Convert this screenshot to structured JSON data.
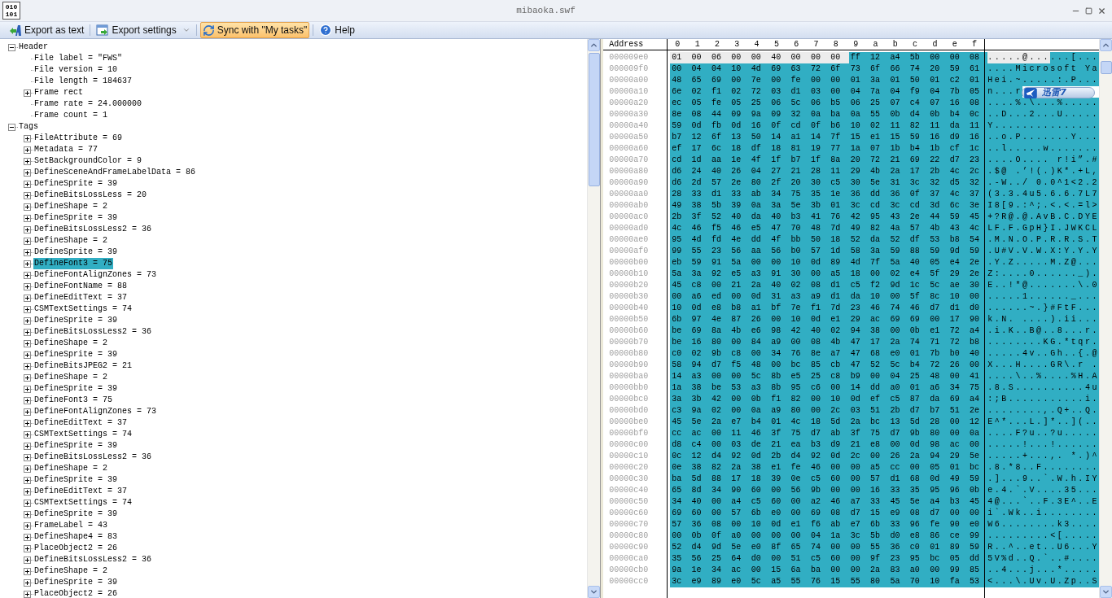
{
  "window": {
    "title": "mibaoka.swf",
    "app_icon_lines": [
      "010",
      "101"
    ]
  },
  "toolbar": [
    {
      "kind": "export-text",
      "label": "Export as text",
      "selected": false
    },
    {
      "kind": "settings",
      "label": "Export settings",
      "selected": false
    },
    {
      "kind": "sync",
      "label": "Sync with \"My tasks\"",
      "selected": true
    },
    {
      "kind": "help",
      "label": "Help",
      "selected": false
    }
  ],
  "tree": [
    {
      "label": "Header",
      "expanded": true,
      "selected": false,
      "children": [
        {
          "label": "File label = \"FWS\"",
          "selected": false
        },
        {
          "label": "File version = 10",
          "selected": false
        },
        {
          "label": "File length = 184637",
          "selected": false
        },
        {
          "label": "Frame rect",
          "expanded": false,
          "selected": false
        },
        {
          "label": "Frame rate = 24.000000",
          "selected": false
        },
        {
          "label": "Frame count = 1",
          "selected": false
        }
      ]
    },
    {
      "label": "Tags",
      "expanded": true,
      "selected": false,
      "children": [
        {
          "label": "FileAttribute = 69",
          "expanded": false,
          "selected": false
        },
        {
          "label": "Metadata = 77",
          "expanded": false,
          "selected": false
        },
        {
          "label": "SetBackgroundColor = 9",
          "expanded": false,
          "selected": false
        },
        {
          "label": "DefineSceneAndFrameLabelData = 86",
          "expanded": false,
          "selected": false
        },
        {
          "label": "DefineSprite = 39",
          "expanded": false,
          "selected": false
        },
        {
          "label": "DefineBitsLossLess = 20",
          "expanded": false,
          "selected": false
        },
        {
          "label": "DefineShape = 2",
          "expanded": false,
          "selected": false
        },
        {
          "label": "DefineSprite = 39",
          "expanded": false,
          "selected": false
        },
        {
          "label": "DefineBitsLossLess2 = 36",
          "expanded": false,
          "selected": false
        },
        {
          "label": "DefineShape = 2",
          "expanded": false,
          "selected": false
        },
        {
          "label": "DefineSprite = 39",
          "expanded": false,
          "selected": false
        },
        {
          "label": "DefineFont3 = 75",
          "expanded": false,
          "selected": true
        },
        {
          "label": "DefineFontAlignZones = 73",
          "expanded": false,
          "selected": false
        },
        {
          "label": "DefineFontName = 88",
          "expanded": false,
          "selected": false
        },
        {
          "label": "DefineEditText = 37",
          "expanded": false,
          "selected": false
        },
        {
          "label": "CSMTextSettings = 74",
          "expanded": false,
          "selected": false
        },
        {
          "label": "DefineSprite = 39",
          "expanded": false,
          "selected": false
        },
        {
          "label": "DefineBitsLossLess2 = 36",
          "expanded": false,
          "selected": false
        },
        {
          "label": "DefineShape = 2",
          "expanded": false,
          "selected": false
        },
        {
          "label": "DefineSprite = 39",
          "expanded": false,
          "selected": false
        },
        {
          "label": "DefineBitsJPEG2 = 21",
          "expanded": false,
          "selected": false
        },
        {
          "label": "DefineShape = 2",
          "expanded": false,
          "selected": false
        },
        {
          "label": "DefineSprite = 39",
          "expanded": false,
          "selected": false
        },
        {
          "label": "DefineFont3 = 75",
          "expanded": false,
          "selected": false
        },
        {
          "label": "DefineFontAlignZones = 73",
          "expanded": false,
          "selected": false
        },
        {
          "label": "DefineEditText = 37",
          "expanded": false,
          "selected": false
        },
        {
          "label": "CSMTextSettings = 74",
          "expanded": false,
          "selected": false
        },
        {
          "label": "DefineSprite = 39",
          "expanded": false,
          "selected": false
        },
        {
          "label": "DefineBitsLossLess2 = 36",
          "expanded": false,
          "selected": false
        },
        {
          "label": "DefineShape = 2",
          "expanded": false,
          "selected": false
        },
        {
          "label": "DefineSprite = 39",
          "expanded": false,
          "selected": false
        },
        {
          "label": "DefineEditText = 37",
          "expanded": false,
          "selected": false
        },
        {
          "label": "CSMTextSettings = 74",
          "expanded": false,
          "selected": false
        },
        {
          "label": "DefineSprite = 39",
          "expanded": false,
          "selected": false
        },
        {
          "label": "FrameLabel = 43",
          "expanded": false,
          "selected": false
        },
        {
          "label": "DefineShape4 = 83",
          "expanded": false,
          "selected": false
        },
        {
          "label": "PlaceObject2 = 26",
          "expanded": false,
          "selected": false
        },
        {
          "label": "DefineBitsLossLess2 = 36",
          "expanded": false,
          "selected": false
        },
        {
          "label": "DefineShape = 2",
          "expanded": false,
          "selected": false
        },
        {
          "label": "DefineSprite = 39",
          "expanded": false,
          "selected": false
        },
        {
          "label": "PlaceObject2 = 26",
          "expanded": false,
          "selected": false
        }
      ]
    }
  ],
  "hex_view": {
    "address_heading": "Address",
    "column_headings": [
      "0",
      "1",
      "2",
      "3",
      "4",
      "5",
      "6",
      "7",
      "8",
      "9",
      "a",
      "b",
      "c",
      "d",
      "e",
      "f"
    ],
    "rows": [
      {
        "address": "000009e0",
        "segments": [
          {
            "hex": "01 00 06 00 00 40 00 00 00",
            "ascii": ".....@...",
            "selected": false
          },
          {
            "hex": "ff 12 a4 5b 00 00 08",
            "ascii": "...[...",
            "selected": true
          }
        ]
      },
      {
        "address": "000009f0",
        "segments": [
          {
            "hex": "00 04 04 10 4d 69 63 72 6f 73 6f 66 74 20 59 61",
            "ascii": "....Microsoft Ya",
            "selected": true
          }
        ]
      },
      {
        "address": "00000a00",
        "segments": [
          {
            "hex": "48 65 69 00 7e 00 fe 00 00 01 3a 01 50 01 c2 01",
            "ascii": "Hei.~.....:.P...",
            "selected": true
          }
        ]
      },
      {
        "address": "00000a10",
        "segments": [
          {
            "hex": "6e 02 f1 02 72 03 d1 03 00 04 7a 04 f9 04 7b 05",
            "ascii": "n...r",
            "selected": true
          }
        ]
      },
      {
        "address": "00000a20",
        "segments": [
          {
            "hex": "ec 05 fe 05 25 06 5c 06 b5 06 25 07 c4 07 16 08",
            "ascii": "....%.\\...%.....",
            "selected": true
          }
        ]
      },
      {
        "address": "00000a30",
        "segments": [
          {
            "hex": "8e 08 44 09 9a 09 32 0a ba 0a 55 0b d4 0b b4 0c",
            "ascii": "..D...2...U.....",
            "selected": true
          }
        ]
      },
      {
        "address": "00000a40",
        "segments": [
          {
            "hex": "59 0d fb 0d 16 0f cd 0f b6 10 02 11 82 11 da 11",
            "ascii": "Y...............",
            "selected": true
          }
        ]
      },
      {
        "address": "00000a50",
        "segments": [
          {
            "hex": "b7 12 6f 13 50 14 a1 14 7f 15 e1 15 59 16 d9 16",
            "ascii": "..o.P.......Y...",
            "selected": true
          }
        ]
      },
      {
        "address": "00000a60",
        "segments": [
          {
            "hex": "ef 17 6c 18 df 18 81 19 77 1a 07 1b b4 1b cf 1c",
            "ascii": "..l.....w.......",
            "selected": true
          }
        ]
      },
      {
        "address": "00000a70",
        "segments": [
          {
            "hex": "cd 1d aa 1e 4f 1f b7 1f 8a 20 72 21 69 22 d7 23",
            "ascii": "....O.... r!i”.#",
            "selected": true
          }
        ]
      },
      {
        "address": "00000a80",
        "segments": [
          {
            "hex": "d6 24 40 26 04 27 21 28 11 29 4b 2a 17 2b 4c 2c",
            "ascii": ".$@ .’!(.)K*.+L,",
            "selected": true
          }
        ]
      },
      {
        "address": "00000a90",
        "segments": [
          {
            "hex": "d6 2d 57 2e 80 2f 20 30 c5 30 5e 31 3c 32 d5 32",
            "ascii": ".-W../ 0.0^1<2.2",
            "selected": true
          }
        ]
      },
      {
        "address": "00000aa0",
        "segments": [
          {
            "hex": "28 33 d1 33 ab 34 75 35 1e 36 dd 36 0f 37 4c 37",
            "ascii": "(3.3.4u5.6.6.7L7",
            "selected": true
          }
        ]
      },
      {
        "address": "00000ab0",
        "segments": [
          {
            "hex": "49 38 5b 39 0a 3a 5e 3b 01 3c cd 3c cd 3d 6c 3e",
            "ascii": "I8[9.:^;.<.<.=l>",
            "selected": true
          }
        ]
      },
      {
        "address": "00000ac0",
        "segments": [
          {
            "hex": "2b 3f 52 40 da 40 b3 41 76 42 95 43 2e 44 59 45",
            "ascii": "+?R@.@.AvB.C.DYE",
            "selected": true
          }
        ]
      },
      {
        "address": "00000ad0",
        "segments": [
          {
            "hex": "4c 46 f5 46 e5 47 70 48 7d 49 82 4a 57 4b 43 4c",
            "ascii": "LF.F.GpH}I.JWKCL",
            "selected": true
          }
        ]
      },
      {
        "address": "00000ae0",
        "segments": [
          {
            "hex": "95 4d fd 4e dd 4f bb 50 18 52 da 52 df 53 b8 54",
            "ascii": ".M.N.O.P.R.R.S.T",
            "selected": true
          }
        ]
      },
      {
        "address": "00000af0",
        "segments": [
          {
            "hex": "99 55 23 56 aa 56 b0 57 1d 58 3a 59 88 59 9d 59",
            "ascii": ".U#V.V.W.X:Y.Y.Y",
            "selected": true
          }
        ]
      },
      {
        "address": "00000b00",
        "segments": [
          {
            "hex": "eb 59 91 5a 00 00 10 0d 89 4d 7f 5a 40 05 e4 2e",
            "ascii": ".Y.Z.....M.Z@...",
            "selected": true
          }
        ]
      },
      {
        "address": "00000b10",
        "segments": [
          {
            "hex": "5a 3a 92 e5 a3 91 30 00 a5 18 00 02 e4 5f 29 2e",
            "ascii": "Z:....0......_).",
            "selected": true
          }
        ]
      },
      {
        "address": "00000b20",
        "segments": [
          {
            "hex": "45 c8 00 21 2a 40 02 08 d1 c5 f2 9d 1c 5c ae 30",
            "ascii": "E..!*@.......\\.0",
            "selected": true
          }
        ]
      },
      {
        "address": "00000b30",
        "segments": [
          {
            "hex": "00 a6 ed 00 0d 31 a3 a9 d1 da 10 00 5f 8c 10 00",
            "ascii": ".....1......_...",
            "selected": true
          }
        ]
      },
      {
        "address": "00000b40",
        "segments": [
          {
            "hex": "10 0d e8 b8 a1 bf 7e f1 7d 23 46 74 46 d7 d1 d0",
            "ascii": "......~.}#FtF...",
            "selected": true
          }
        ]
      },
      {
        "address": "00000b50",
        "segments": [
          {
            "hex": "6b 97 4e 87 26 00 10 0d e1 29 ac 69 69 00 17 90",
            "ascii": "k.N. ....).ii...",
            "selected": true
          }
        ]
      },
      {
        "address": "00000b60",
        "segments": [
          {
            "hex": "be 69 8a 4b e6 98 42 40 02 94 38 00 0b e1 72 a4",
            "ascii": ".i.K..B@..8...r.",
            "selected": true
          }
        ]
      },
      {
        "address": "00000b70",
        "segments": [
          {
            "hex": "be 16 80 00 84 a9 00 08 4b 47 17 2a 74 71 72 b8",
            "ascii": "........KG.*tqr.",
            "selected": true
          }
        ]
      },
      {
        "address": "00000b80",
        "segments": [
          {
            "hex": "c0 02 9b c8 00 34 76 8e a7 47 68 e0 01 7b b0 40",
            "ascii": ".....4v..Gh..{.@",
            "selected": true
          }
        ]
      },
      {
        "address": "00000b90",
        "segments": [
          {
            "hex": "58 94 d7 f5 48 00 bc 85 cb 47 52 5c b4 72 26 00",
            "ascii": "X...H....GR\\.r .",
            "selected": true
          }
        ]
      },
      {
        "address": "00000ba0",
        "segments": [
          {
            "hex": "14 a3 00 00 5c 8b e5 25 c8 b9 00 04 25 48 00 41",
            "ascii": "....\\..%....%H.A",
            "selected": true
          }
        ]
      },
      {
        "address": "00000bb0",
        "segments": [
          {
            "hex": "1a 38 be 53 a3 8b 95 c6 00 14 dd a0 01 a6 34 75",
            "ascii": ".8.S..........4u",
            "selected": true
          }
        ]
      },
      {
        "address": "00000bc0",
        "segments": [
          {
            "hex": "3a 3b 42 00 0b f1 82 00 10 0d ef c5 87 da 69 a4",
            "ascii": ":;B...........i.",
            "selected": true
          }
        ]
      },
      {
        "address": "00000bd0",
        "segments": [
          {
            "hex": "c3 9a 02 00 0a a9 80 00 2c 03 51 2b d7 b7 51 2e",
            "ascii": "........,.Q+..Q.",
            "selected": true
          }
        ]
      },
      {
        "address": "00000be0",
        "segments": [
          {
            "hex": "45 5e 2a e7 b4 01 4c 18 5d 2a bc 13 5d 28 00 12",
            "ascii": "E^*...L.]*..](..",
            "selected": true
          }
        ]
      },
      {
        "address": "00000bf0",
        "segments": [
          {
            "hex": "cc ac 00 11 46 3f 75 d7 ab 3f 75 d7 9b 80 00 0a",
            "ascii": "....F?u..?u.....",
            "selected": true
          }
        ]
      },
      {
        "address": "00000c00",
        "segments": [
          {
            "hex": "d8 c4 00 03 de 21 ea b3 d9 21 e8 00 0d 98 ac 00",
            "ascii": ".....!...!......",
            "selected": true
          }
        ]
      },
      {
        "address": "00000c10",
        "segments": [
          {
            "hex": "0c 12 d4 92 0d 2b d4 92 0d 2c 00 26 2a 94 29 5e",
            "ascii": ".....+...,. *.)^",
            "selected": true
          }
        ]
      },
      {
        "address": "00000c20",
        "segments": [
          {
            "hex": "0e 38 82 2a 38 e1 fe 46 00 00 a5 cc 00 05 01 bc",
            "ascii": ".8.*8..F........",
            "selected": true
          }
        ]
      },
      {
        "address": "00000c30",
        "segments": [
          {
            "hex": "ba 5d 88 17 18 39 0e c5 60 00 57 d1 68 0d 49 59",
            "ascii": ".]...9..`.W.h.IY",
            "selected": true
          }
        ]
      },
      {
        "address": "00000c40",
        "segments": [
          {
            "hex": "65 8d 34 90 60 00 56 9b 00 00 16 33 35 95 96 0b",
            "ascii": "e.4.`.V....35...",
            "selected": true
          }
        ]
      },
      {
        "address": "00000c50",
        "segments": [
          {
            "hex": "34 40 00 a4 c5 60 00 a2 46 a7 33 45 5e a4 b3 45",
            "ascii": "4@...`..F.3E^..E",
            "selected": true
          }
        ]
      },
      {
        "address": "00000c60",
        "segments": [
          {
            "hex": "69 60 00 57 6b e0 00 69 08 d7 15 e9 08 d7 00 00",
            "ascii": "i`.Wk..i........",
            "selected": true
          }
        ]
      },
      {
        "address": "00000c70",
        "segments": [
          {
            "hex": "57 36 08 00 10 0d e1 f6 ab e7 6b 33 96 fe 90 e0",
            "ascii": "W6........k3....",
            "selected": true
          }
        ]
      },
      {
        "address": "00000c80",
        "segments": [
          {
            "hex": "00 0b 0f a0 00 00 00 04 1a 3c 5b d0 e8 86 ce 99",
            "ascii": ".........<[.....",
            "selected": true
          }
        ]
      },
      {
        "address": "00000c90",
        "segments": [
          {
            "hex": "52 d4 9d 5e e0 8f 65 74 00 00 55 36 c0 01 89 59",
            "ascii": "R..^..et..U6...Y",
            "selected": true
          }
        ]
      },
      {
        "address": "00000ca0",
        "segments": [
          {
            "hex": "35 56 25 64 d0 00 51 c5 60 00 9f 23 95 bc 05 dd",
            "ascii": "5V%d..Q.`..#....",
            "selected": true
          }
        ]
      },
      {
        "address": "00000cb0",
        "segments": [
          {
            "hex": "9a 1e 34 ac 00 15 6a ba 00 00 2a 83 a0 00 99 85",
            "ascii": "..4...j...*.....",
            "selected": true
          }
        ]
      },
      {
        "address": "00000cc0",
        "segments": [
          {
            "hex": "3c e9 89 e0 5c a5 55 76 15 55 80 5a 70 10 fa 53",
            "ascii": "<...\\.Uv.U.Zp..S",
            "selected": true
          }
        ]
      }
    ]
  },
  "floating_widget": {
    "label": "迅雷7"
  }
}
